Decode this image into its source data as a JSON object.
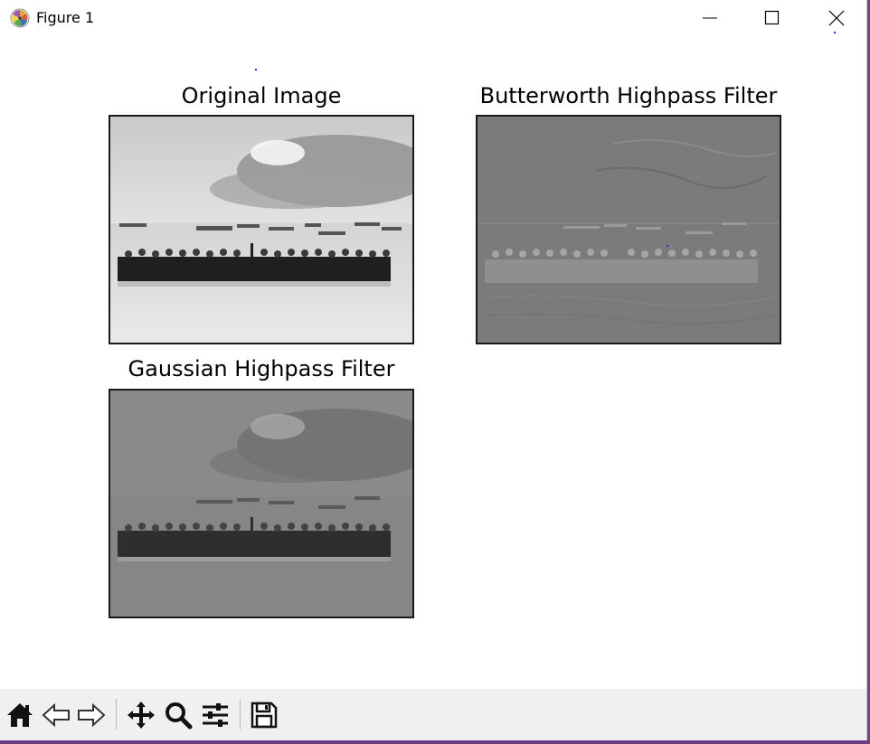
{
  "window": {
    "title": "Figure 1",
    "icon": "matplotlib-icon",
    "controls": [
      "minimize-icon",
      "maximize-icon",
      "close-icon"
    ]
  },
  "figure": {
    "subplots": [
      {
        "title": "Original Image",
        "image": "grayscale photo of group standing in sea under cloudy sky"
      },
      {
        "title": "Butterworth Highpass Filter",
        "image": "edge-enhanced gray filtered photo"
      },
      {
        "title": "Gaussian Highpass Filter",
        "image": "edge-enhanced gray filtered photo"
      }
    ]
  },
  "toolbar": {
    "items": [
      "home-icon",
      "back-icon",
      "forward-icon",
      "pan-icon",
      "zoom-icon",
      "configure-subplots-icon",
      "save-icon"
    ]
  }
}
